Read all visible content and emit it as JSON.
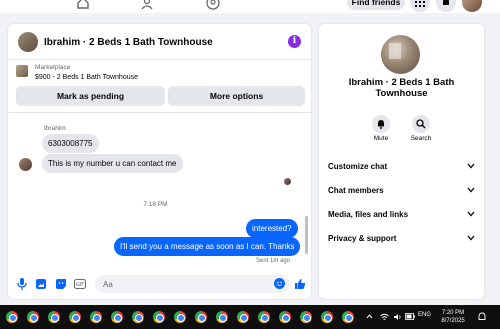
{
  "nav": {
    "find_friends_label": "Find friends"
  },
  "chat": {
    "title": "Ibrahim · 2 Beds 1 Bath Townhouse",
    "marketplace_label": "Marketplace",
    "listing_price_title": "$900 - 2 Beds 1 Bath Townhouse",
    "mark_pending_label": "Mark as pending",
    "more_options_label": "More options",
    "sender_name": "Ibrahim",
    "incoming_messages": [
      "6303008775",
      "This is my number u can contact me"
    ],
    "timestamp": "7:18 PM",
    "outgoing_messages": [
      "interested?",
      "I'll send you a message as soon as I can. Thanks"
    ],
    "sent_status": "Sent 1m ago",
    "composer_placeholder": "Aa"
  },
  "sidebar": {
    "name": "Ibrahim · 2 Beds 1 Bath Townhouse",
    "mute_label": "Mute",
    "search_label": "Search",
    "menu_items": [
      "Customize chat",
      "Chat members",
      "Media, files and links",
      "Privacy & support"
    ]
  },
  "taskbar": {
    "language": "ENG",
    "time": "7:20 PM",
    "date": "8/7/2025",
    "app_icons": [
      "chrome-icon"
    ]
  },
  "colors": {
    "accent": "#0866ff",
    "info": "#8a2be2"
  }
}
